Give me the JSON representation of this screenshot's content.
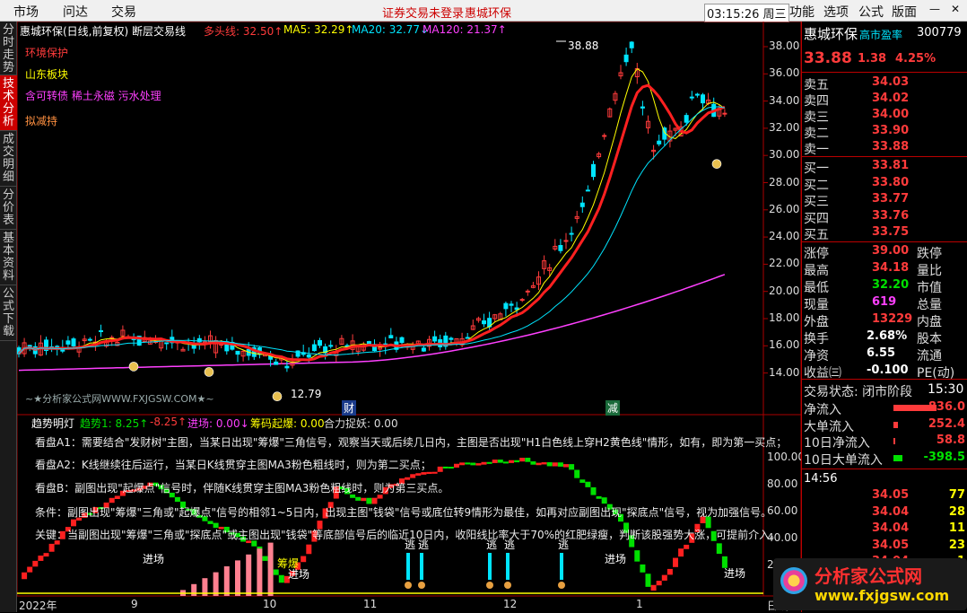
{
  "menubar": {
    "items": [
      "市场",
      "问达",
      "交易"
    ],
    "notice": "证券交易未登录",
    "stock_title": "惠城环保",
    "clock": "03:15:26 周三",
    "right_items": [
      "功能",
      "选项",
      "公式",
      "版面"
    ]
  },
  "left_tabs": [
    "分时走势",
    "技术分析",
    "成交明细",
    "分价表",
    "基本资料",
    "公式下载"
  ],
  "main_chart": {
    "title": "惠城环保(日线,前复权)",
    "indicator": "断层交易线",
    "legend": [
      {
        "label": "多头线: 32.50↑",
        "color": "#ff3b3b"
      },
      {
        "label": "MA5: 32.29↑",
        "color": "#ffff00"
      },
      {
        "label": "MA20: 32.77↓",
        "color": "#00e5ff"
      },
      {
        "label": "MA120: 21.37↑",
        "color": "#ff40ff"
      }
    ],
    "tags": [
      {
        "text": "环境保护",
        "color": "#ff3b3b"
      },
      {
        "text": "山东板块",
        "color": "#ffff00"
      },
      {
        "text": "含可转债 稀土永磁 污水处理",
        "color": "#ff40ff"
      },
      {
        "text": "拟减持",
        "color": "#ff9040"
      }
    ],
    "high_label": "38.88",
    "low_label": "12.79",
    "watermark": "~★分析家公式网WWW.FXJGSW.COM★~",
    "markers": [
      "财",
      "减"
    ],
    "y_ticks": [
      "38.00",
      "36.00",
      "34.00",
      "32.00",
      "30.00",
      "28.00",
      "26.00",
      "24.00",
      "22.00",
      "20.00",
      "18.00",
      "16.00",
      "14.00"
    ]
  },
  "sub_chart": {
    "title": "趋势明灯",
    "legend": [
      {
        "label": "趋势1: 8.25↑",
        "color": "#00e000"
      },
      {
        "label": "-8.25↑",
        "color": "#ff3b3b"
      },
      {
        "label": "进场: 0.00↓",
        "color": "#ff40ff"
      },
      {
        "label": "筹码起爆: 0.00",
        "color": "#ffff00"
      },
      {
        "label": "合力捉妖: 0.00",
        "color": "#dddddd"
      }
    ],
    "notes": [
      "看盘A1：需要结合\"发财树\"主图，当某日出现\"筹爆\"三角信号，观察当天或后续几日内，主图是否出现\"H1白色线上穿H2黄色线\"情形，如有，即为第一买点；",
      "看盘A2：K线继续往后运行，当某日K线贯穿主图MA3粉色粗线时，则为第二买点；",
      "看盘B：副图出现\"起爆点\"信号时，伴随K线贯穿主图MA3粉色粗线时，则为第三买点。",
      "条件：副图出现\"筹爆\"三角或\"起爆点\"信号的相邻1~5日内，出现主图\"钱袋\"信号或底位转9情形为最佳，如再对应副图出现\"探底点\"信号，视为加强信号。",
      "关键：当副图出现\"筹爆\"三角或\"探底点\"或主图出现\"钱袋\"等底部信号后的临近10日内，收阳线比率大于70%的红肥绿瘦，判断该股强势大涨，可提前介入。"
    ],
    "signals": [
      "进场",
      "筹爆",
      "进场",
      "逃",
      "逃",
      "逃",
      "逃",
      "逃",
      "进场",
      "进场"
    ],
    "y_ticks": [
      "100.00",
      "80.00",
      "60.00",
      "40.00",
      "20.00"
    ]
  },
  "x_axis": {
    "labels": [
      "2022年",
      "9",
      "10",
      "11",
      "12",
      "1"
    ],
    "suffix": "日线"
  },
  "quote": {
    "name": "惠城环保",
    "sub": "高市盈率",
    "code": "300779",
    "price": "33.88",
    "change": "1.38",
    "pct": "4.25%",
    "asks": [
      {
        "label": "卖五",
        "price": "34.03"
      },
      {
        "label": "卖四",
        "price": "34.02"
      },
      {
        "label": "卖三",
        "price": "34.00"
      },
      {
        "label": "卖二",
        "price": "33.90"
      },
      {
        "label": "卖一",
        "price": "33.88"
      }
    ],
    "bids": [
      {
        "label": "买一",
        "price": "33.81"
      },
      {
        "label": "买二",
        "price": "33.80"
      },
      {
        "label": "买三",
        "price": "33.77"
      },
      {
        "label": "买四",
        "price": "33.76"
      },
      {
        "label": "买五",
        "price": "33.75"
      }
    ],
    "stats": [
      {
        "label": "涨停",
        "value": "39.00",
        "color": "#ff3b3b",
        "label2": "跌停"
      },
      {
        "label": "最高",
        "value": "34.18",
        "color": "#ff3b3b",
        "label2": "量比"
      },
      {
        "label": "最低",
        "value": "32.20",
        "color": "#00e000",
        "label2": "市值"
      },
      {
        "label": "现量",
        "value": "619",
        "color": "#ff40ff",
        "label2": "总量"
      },
      {
        "label": "外盘",
        "value": "13229",
        "color": "#ff3b3b",
        "label2": "内盘"
      },
      {
        "label": "换手",
        "value": "2.68%",
        "color": "#ffffff",
        "label2": "股本"
      },
      {
        "label": "净资",
        "value": "6.55",
        "color": "#ffffff",
        "label2": "流通"
      },
      {
        "label": "收益㈢",
        "value": "-0.100",
        "color": "#ffffff",
        "label2": "PE(动)"
      }
    ],
    "trade_state": "交易状态: 闭市阶段",
    "trade_time": "15:30",
    "flows": [
      {
        "label": "净流入",
        "value": "836.0",
        "color": "#ff3b3b",
        "bar": 0.95
      },
      {
        "label": "大单流入",
        "value": "252.4",
        "color": "#ff3b3b",
        "bar": 0.1
      },
      {
        "label": "10日净流入",
        "value": "58.8",
        "color": "#ff3b3b",
        "bar": 0.03
      },
      {
        "label": "10日大单流入",
        "value": "-398.5",
        "color": "#00e000",
        "bar": 0.2
      }
    ],
    "ticks_time": "14:56",
    "ticks": [
      {
        "price": "34.05",
        "vol": "77"
      },
      {
        "price": "34.04",
        "vol": "28"
      },
      {
        "price": "34.04",
        "vol": "11"
      },
      {
        "price": "34.05",
        "vol": "23"
      },
      {
        "price": "34.04",
        "vol": "1"
      }
    ]
  },
  "logo": {
    "title": "分析家公式网",
    "url": "www.fxjgsw.com"
  }
}
